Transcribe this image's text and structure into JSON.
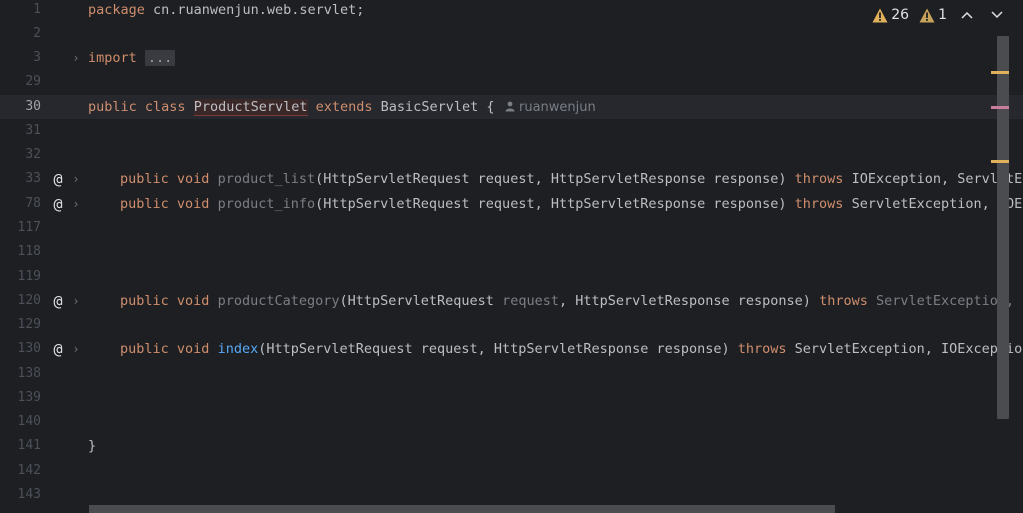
{
  "status": {
    "warnings_count": "26",
    "weak_warnings_count": "1",
    "warning_icon": "warning-triangle-icon",
    "up_icon": "chevron-up-icon",
    "down_icon": "chevron-down-icon"
  },
  "lines": {
    "l1": {
      "num": "1",
      "text": "package cn.ruanwenjun.web.servlet;"
    },
    "l2": {
      "num": "2"
    },
    "l3": {
      "num": "3"
    },
    "l29": {
      "num": "29"
    },
    "l30": {
      "num": "30"
    },
    "l31": {
      "num": "31"
    },
    "l32": {
      "num": "32"
    },
    "l33": {
      "num": "33"
    },
    "l78": {
      "num": "78"
    },
    "l117": {
      "num": "117"
    },
    "l118": {
      "num": "118"
    },
    "l119": {
      "num": "119"
    },
    "l120": {
      "num": "120"
    },
    "l129": {
      "num": "129"
    },
    "l130": {
      "num": "130"
    },
    "l138": {
      "num": "138"
    },
    "l139": {
      "num": "139"
    },
    "l140": {
      "num": "140"
    },
    "l141": {
      "num": "141",
      "text": "}"
    },
    "l142": {
      "num": "142"
    },
    "l143": {
      "num": "143"
    }
  },
  "tokens": {
    "package_stmt": "package",
    "package_name": " cn.ruanwenjun.web.servlet;",
    "import_kw": "import",
    "import_fold": "...",
    "public": "public",
    "class": "class",
    "class_name": "ProductServlet",
    "extends": "extends",
    "base_class": " BasicServlet {",
    "author": "ruanwenjun",
    "void": "void",
    "throws": "throws",
    "m33_name": "product_list",
    "m33_params": "(HttpServletRequest request, HttpServletResponse response) ",
    "m33_exc": " IOException, ServletE",
    "m78_name": "product_info",
    "m78_params": "(HttpServletRequest request, HttpServletResponse response) ",
    "m78_exc": " ServletException, IOEx",
    "m120_name": "productCategory",
    "m120_p1": "(HttpServletRequest ",
    "m120_p2": "request",
    "m120_p3": ", HttpServletResponse response) ",
    "m120_exc": " ServletException,",
    "m130_name": "index",
    "m130_params": "(HttpServletRequest request, HttpServletResponse response) ",
    "m130_exc": " ServletException, IOExceptio"
  },
  "markers": {
    "override_icon": "@",
    "fold_icon": "›"
  },
  "colors": {
    "background": "#1e1f22",
    "keyword": "#cf8e6d",
    "method": "#56a8f5",
    "warning": "#e0b15a",
    "error_stripe": "#c77d9b"
  }
}
